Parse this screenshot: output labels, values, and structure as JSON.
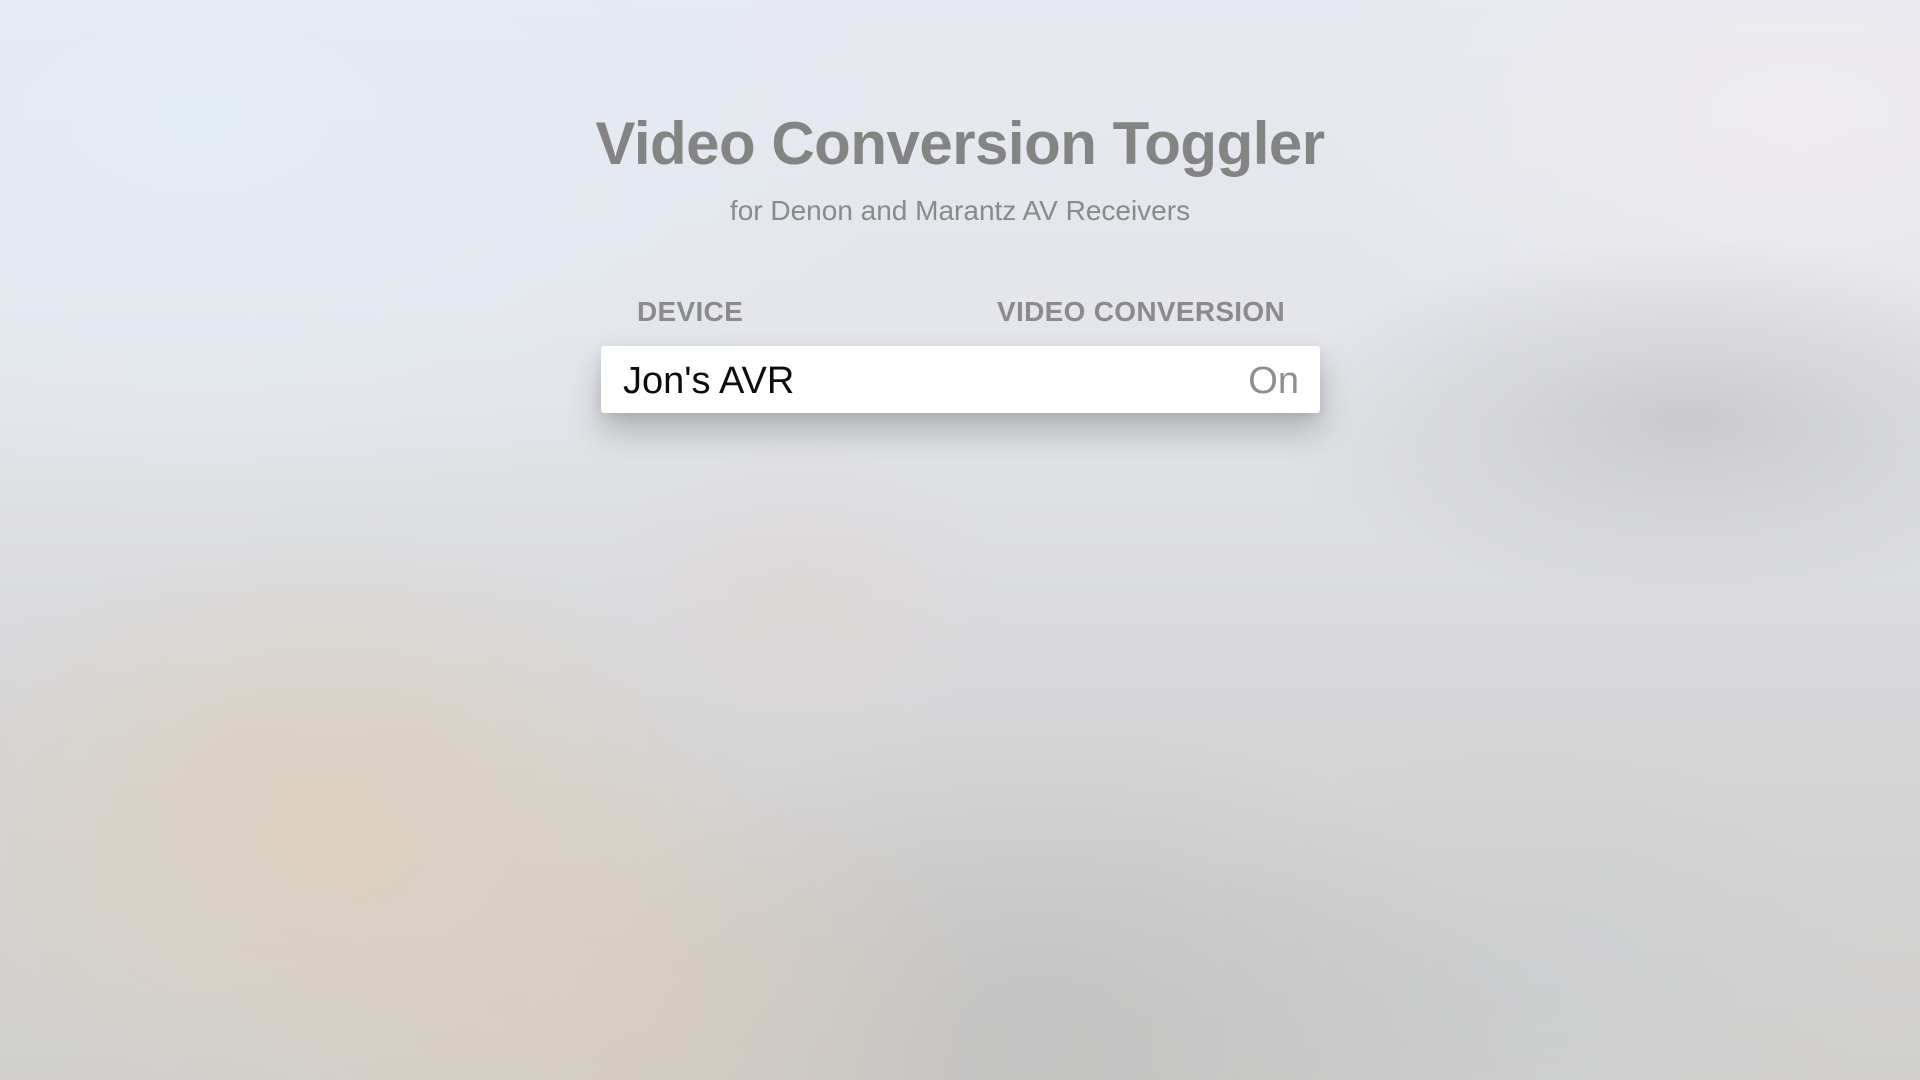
{
  "app": {
    "title": "Video Conversion Toggler",
    "subtitle": "for Denon and Marantz AV Receivers"
  },
  "table": {
    "columns": {
      "device": "DEVICE",
      "video_conversion": "VIDEO CONVERSION"
    },
    "rows": [
      {
        "device": "Jon's AVR",
        "video_conversion": "On",
        "focused": true
      }
    ]
  },
  "colors": {
    "title": "#848484",
    "header_text": "#8b8b8b",
    "row_background": "#ffffff",
    "row_device_text": "#0d0d0d",
    "row_value_text": "#8e8e8e"
  }
}
